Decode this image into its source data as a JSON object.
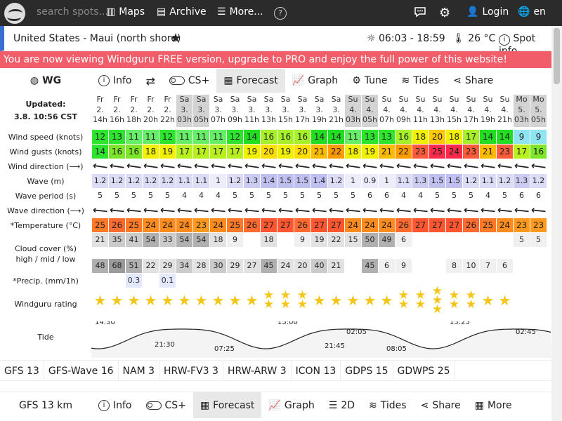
{
  "topbar": {
    "search_placeholder": "search spots...",
    "nav": [
      {
        "label": "Maps",
        "icon": "map-icon"
      },
      {
        "label": "Archive",
        "icon": "archive-icon"
      },
      {
        "label": "More...",
        "icon": "menu-icon"
      }
    ],
    "login_label": "Login",
    "lang_label": "en"
  },
  "spot": {
    "name": "United States - Maui (north shore)",
    "sun": "06:03 - 18:59",
    "temp": "26 °C",
    "spot_info": "Spot info"
  },
  "banner": "You are now viewing Windguru FREE version, upgrade to PRO and enjoy the full power of this website!",
  "tabs": [
    {
      "label": "WG",
      "icon": "wg-logo-icon"
    },
    {
      "label": "Info",
      "icon": "info-icon"
    },
    {
      "label": "",
      "icon": "swap-icon"
    },
    {
      "label": "CS+",
      "icon": "toggle-icon"
    },
    {
      "label": "Forecast",
      "icon": "table-icon",
      "active": true
    },
    {
      "label": "Graph",
      "icon": "graph-icon"
    },
    {
      "label": "Tune",
      "icon": "tune-icon"
    },
    {
      "label": "Tides",
      "icon": "tides-icon"
    },
    {
      "label": "Share",
      "icon": "share-icon"
    }
  ],
  "table": {
    "updated_label": "Updated:",
    "updated_value": "3.8. 10:56 CST",
    "row_labels": [
      "Wind speed (knots)",
      "Wind gusts (knots)",
      "Wind direction (⟶)",
      "Wave (m)",
      "Wave period (s)",
      "Wave direction (⟶)",
      "*Temperature (°C)",
      "Cloud cover (%)\nhigh / mid / low",
      "*Precip. (mm/1h)",
      "Windguru rating",
      "Tide"
    ],
    "columns": [
      {
        "d": "Fr",
        "n": "2.",
        "h": "14h",
        "night": false
      },
      {
        "d": "Fr",
        "n": "2.",
        "h": "16h",
        "night": false
      },
      {
        "d": "Fr",
        "n": "2.",
        "h": "18h",
        "night": false
      },
      {
        "d": "Fr",
        "n": "2.",
        "h": "20h",
        "night": false
      },
      {
        "d": "Fr",
        "n": "2.",
        "h": "22h",
        "night": false
      },
      {
        "d": "Sa",
        "n": "3.",
        "h": "03h",
        "night": true
      },
      {
        "d": "Sa",
        "n": "3.",
        "h": "05h",
        "night": true
      },
      {
        "d": "Sa",
        "n": "3.",
        "h": "07h",
        "night": false
      },
      {
        "d": "Sa",
        "n": "3.",
        "h": "09h",
        "night": false
      },
      {
        "d": "Sa",
        "n": "3.",
        "h": "11h",
        "night": false
      },
      {
        "d": "Sa",
        "n": "3.",
        "h": "13h",
        "night": false
      },
      {
        "d": "Sa",
        "n": "3.",
        "h": "15h",
        "night": false
      },
      {
        "d": "Sa",
        "n": "3.",
        "h": "17h",
        "night": false
      },
      {
        "d": "Sa",
        "n": "3.",
        "h": "19h",
        "night": false
      },
      {
        "d": "Sa",
        "n": "3.",
        "h": "21h",
        "night": false
      },
      {
        "d": "Su",
        "n": "4.",
        "h": "03h",
        "night": true
      },
      {
        "d": "Su",
        "n": "4.",
        "h": "05h",
        "night": true
      },
      {
        "d": "Su",
        "n": "4.",
        "h": "07h",
        "night": false
      },
      {
        "d": "Su",
        "n": "4.",
        "h": "09h",
        "night": false
      },
      {
        "d": "Su",
        "n": "4.",
        "h": "11h",
        "night": false
      },
      {
        "d": "Su",
        "n": "4.",
        "h": "13h",
        "night": false
      },
      {
        "d": "Su",
        "n": "4.",
        "h": "15h",
        "night": false
      },
      {
        "d": "Su",
        "n": "4.",
        "h": "17h",
        "night": false
      },
      {
        "d": "Su",
        "n": "4.",
        "h": "19h",
        "night": false
      },
      {
        "d": "Su",
        "n": "4.",
        "h": "21h",
        "night": false
      },
      {
        "d": "Mo",
        "n": "5.",
        "h": "03h",
        "night": true
      },
      {
        "d": "Mo",
        "n": "5.",
        "h": "05h",
        "night": true
      }
    ],
    "wind_speed": [
      "12",
      "13",
      "11",
      "11",
      "12",
      "11",
      "11",
      "11",
      "12",
      "14",
      "16",
      "16",
      "16",
      "14",
      "14",
      "11",
      "13",
      "13",
      "16",
      "18",
      "20",
      "18",
      "17",
      "14",
      "14",
      "9",
      "9"
    ],
    "wind_gusts": [
      "14",
      "16",
      "16",
      "18",
      "19",
      "17",
      "17",
      "17",
      "17",
      "19",
      "20",
      "19",
      "20",
      "21",
      "22",
      "18",
      "19",
      "21",
      "22",
      "23",
      "25",
      "24",
      "23",
      "21",
      "23",
      "17",
      "16"
    ],
    "wave": [
      "1.2",
      "1.2",
      "1.2",
      "1.2",
      "1.2",
      "1.1",
      "1.1",
      "1",
      "1.2",
      "1.3",
      "1.4",
      "1.5",
      "1.5",
      "1.4",
      "1.2",
      "1",
      "0.9",
      "1",
      "1.1",
      "1.3",
      "1.5",
      "1.5",
      "1.2",
      "1.1",
      "1.2",
      "1.3",
      "1.2"
    ],
    "wave_period": [
      "5",
      "5",
      "5",
      "5",
      "5",
      "4",
      "4",
      "4",
      "5",
      "5",
      "5",
      "5",
      "5",
      "5",
      "5",
      "5",
      "6",
      "6",
      "4",
      "4",
      "5",
      "5",
      "5",
      "4",
      "5",
      "6",
      "6"
    ],
    "temperature": [
      "25",
      "26",
      "25",
      "24",
      "24",
      "24",
      "23",
      "24",
      "25",
      "26",
      "27",
      "27",
      "26",
      "27",
      "27",
      "24",
      "24",
      "24",
      "26",
      "27",
      "27",
      "27",
      "26",
      "25",
      "24",
      "23",
      "23"
    ],
    "cloud_high": [
      "",
      "",
      "",
      "",
      "",
      "",
      "",
      "",
      "",
      "",
      "",
      "",
      "",
      "",
      "",
      "",
      "",
      "",
      "",
      "",
      "",
      "",
      "",
      "",
      "",
      "",
      ""
    ],
    "cloud_mid": [
      "21",
      "35",
      "41",
      "54",
      "33",
      "54",
      "54",
      "18",
      "9",
      "",
      "18",
      "",
      "9",
      "19",
      "22",
      "15",
      "50",
      "49",
      "6",
      "",
      "",
      "",
      "",
      "",
      "",
      "5",
      "5"
    ],
    "cloud_low": [
      "48",
      "68",
      "51",
      "22",
      "29",
      "34",
      "28",
      "30",
      "29",
      "27",
      "45",
      "24",
      "20",
      "40",
      "21",
      "",
      "45",
      "6",
      "9",
      "",
      "",
      "8",
      "10",
      "7",
      "6",
      "",
      ""
    ],
    "precip": [
      "",
      "",
      "0.3",
      "",
      "0.1",
      "",
      "",
      "",
      "",
      "",
      "",
      "",
      "",
      "",
      "",
      "",
      "",
      "",
      "",
      "",
      "",
      "",
      "",
      "",
      "",
      "",
      ""
    ],
    "rating": [
      1,
      1,
      1,
      1,
      1,
      1,
      1,
      1,
      1,
      1,
      2,
      2,
      2,
      1,
      1,
      1,
      1,
      1,
      2,
      2,
      3,
      2,
      2,
      1,
      1,
      0,
      0
    ],
    "tide_labels": [
      "14:30",
      "21:30",
      "07:25",
      "15:00",
      "21:45",
      "02:05",
      "08:05",
      "15:25",
      "02:45"
    ]
  },
  "models": [
    "GFS 13",
    "GFS-Wave 16",
    "NAM 3",
    "HRW-FV3 3",
    "HRW-ARW 3",
    "ICON 13",
    "GDPS 15",
    "GDWPS 25"
  ],
  "tabs2": [
    {
      "label": "GFS 13 km",
      "icon": ""
    },
    {
      "label": "Info",
      "icon": "info-icon"
    },
    {
      "label": "CS+",
      "icon": "toggle-icon"
    },
    {
      "label": "Forecast",
      "icon": "table-icon",
      "active": true
    },
    {
      "label": "Graph",
      "icon": "graph-icon"
    },
    {
      "label": "2D",
      "icon": "layers-icon"
    },
    {
      "label": "Tides",
      "icon": "tides-icon"
    },
    {
      "label": "Share",
      "icon": "share-icon"
    },
    {
      "label": "More",
      "icon": "grid-icon"
    }
  ],
  "colors": {
    "topbar": "#2b2b2b",
    "banner": "#f25d6a",
    "spot_accent": "#3a6fcf",
    "rating_star": "#f5c518"
  }
}
